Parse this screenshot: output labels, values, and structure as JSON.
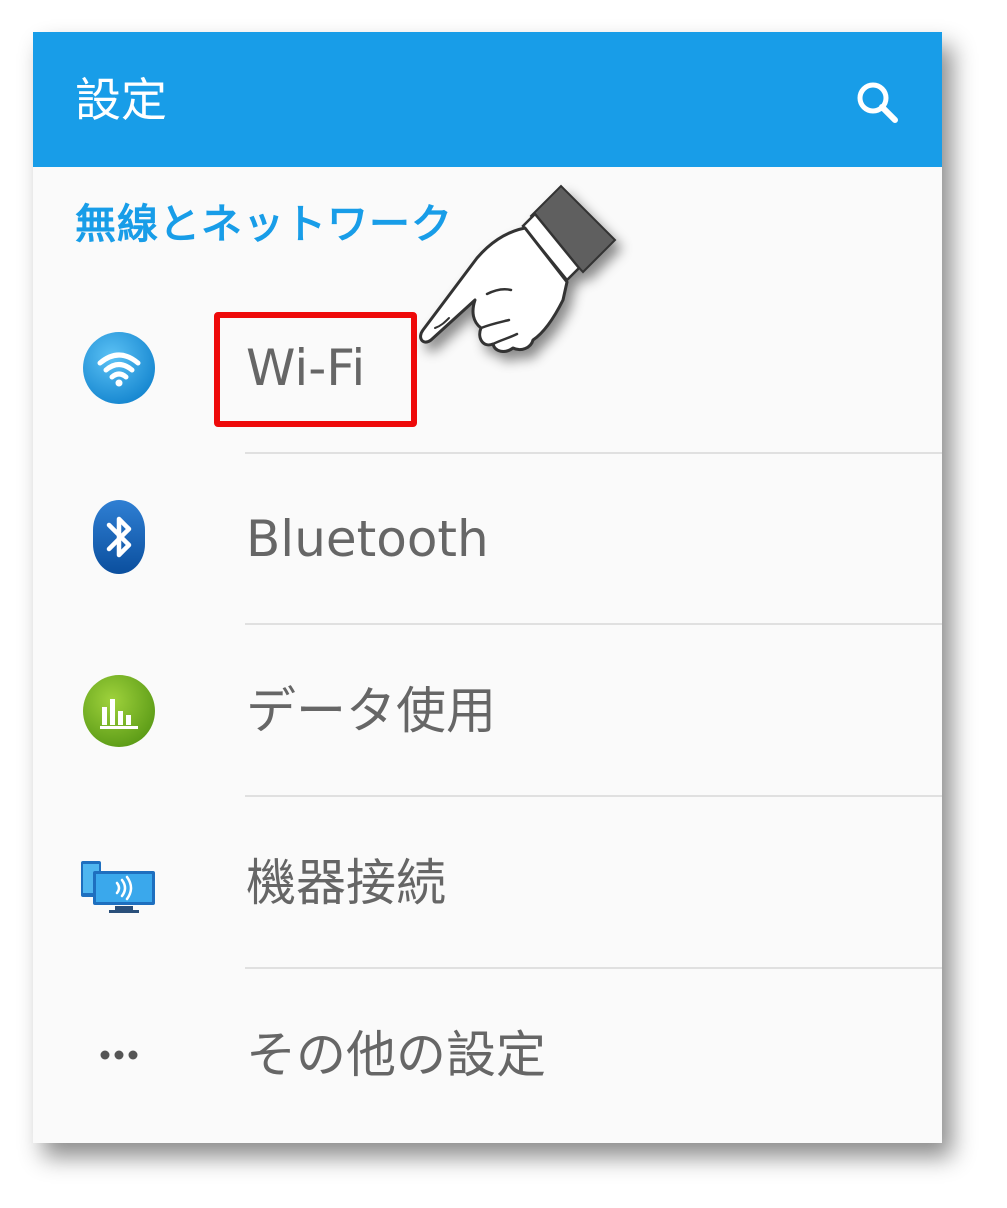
{
  "appbar": {
    "title": "設定",
    "search_icon": "search-icon",
    "color": "#189de8"
  },
  "section": {
    "header": "無線とネットワーク"
  },
  "items": [
    {
      "label": "Wi-Fi",
      "icon": "wifi-icon"
    },
    {
      "label": "Bluetooth",
      "icon": "bluetooth-icon"
    },
    {
      "label": "データ使用",
      "icon": "data-usage-icon"
    },
    {
      "label": "機器接続",
      "icon": "device-connection-icon"
    },
    {
      "label": "その他の設定",
      "icon": "more-icon"
    }
  ],
  "annotation": {
    "highlight_color": "#ee0a0a",
    "pointer_icon": "pointing-hand-icon",
    "highlighted_item": "Wi-Fi"
  }
}
